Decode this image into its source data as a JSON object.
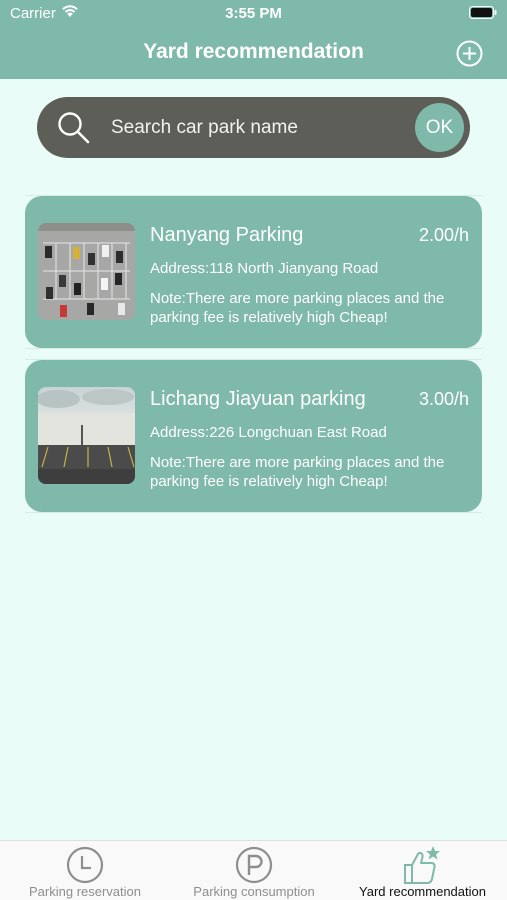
{
  "status_bar": {
    "carrier": "Carrier",
    "time": "3:55 PM",
    "icons": [
      "wifi-icon",
      "battery-icon"
    ]
  },
  "header": {
    "title": "Yard recommendation",
    "add_icon": "plus-circle-icon"
  },
  "search": {
    "placeholder": "Search car park name",
    "value": "",
    "ok_label": "OK",
    "icon": "search-icon"
  },
  "parking_list": [
    {
      "name": "Nanyang Parking",
      "price": "2.00/h",
      "address": "Address:118 North Jianyang Road",
      "note": "Note:There are more parking places and the parking fee is relatively high Cheap!",
      "image": "aerial-parking-lot-photo"
    },
    {
      "name": "Lichang Jiayuan parking",
      "price": "3.00/h",
      "address": "Address:226 Longchuan East Road",
      "note": "Note:There are more parking places and the parking fee is relatively high Cheap!",
      "image": "empty-parking-lot-photo"
    }
  ],
  "tab_bar": {
    "tabs": [
      {
        "label": "Parking reservation",
        "icon": "clock-icon",
        "active": false
      },
      {
        "label": "Parking consumption",
        "icon": "parking-p-icon",
        "active": false
      },
      {
        "label": "Yard recommendation",
        "icon": "thumbs-up-star-icon",
        "active": true
      }
    ]
  },
  "colors": {
    "accent": "#7fb9aa",
    "background": "#e9fcf7",
    "search_bar": "#5d5e58",
    "tab_active": "#7fb9aa",
    "tab_inactive": "#8e8e8e"
  }
}
